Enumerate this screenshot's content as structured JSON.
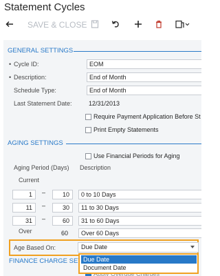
{
  "page": {
    "title": "Statement Cycles"
  },
  "toolbar": {
    "save_close_label": "SAVE & CLOSE"
  },
  "general": {
    "section_title": "GENERAL SETTINGS",
    "cycle_id_label": "Cycle ID:",
    "cycle_id_value": "EOM",
    "description_label": "Description:",
    "description_value": "End of Month",
    "schedule_type_label": "Schedule Type:",
    "schedule_type_value": "End of Month",
    "last_statement_label": "Last Statement Date:",
    "last_statement_value": "12/31/2013",
    "require_payment_label": "Require Payment Application Before St",
    "print_empty_label": "Print Empty Statements"
  },
  "aging": {
    "section_title": "AGING SETTINGS",
    "use_financial_label": "Use Financial Periods for Aging",
    "period_header": "Aging Period (Days)",
    "description_header": "Description",
    "current_label": "Current",
    "over_label": "Over",
    "rows": [
      {
        "from": "1",
        "to": "10",
        "desc": "0 to 10 Days"
      },
      {
        "from": "11",
        "to": "30",
        "desc": "11 to 30 Days"
      },
      {
        "from": "31",
        "to": "60",
        "desc": "31 to 60 Days"
      }
    ],
    "over_value": "60",
    "over_desc": "Over 60 Days",
    "age_based_on_label": "Age Based On:",
    "age_based_on_value": "Due Date",
    "options": [
      "Due Date",
      "Document Date"
    ]
  },
  "finance": {
    "section_title": "FINANCE CHARGE SET",
    "apply_overdue_label": "Apply Overdue Charges"
  },
  "colors": {
    "accent": "#2879c8",
    "highlight": "#f0a020",
    "panel": "#f3f5f7"
  }
}
